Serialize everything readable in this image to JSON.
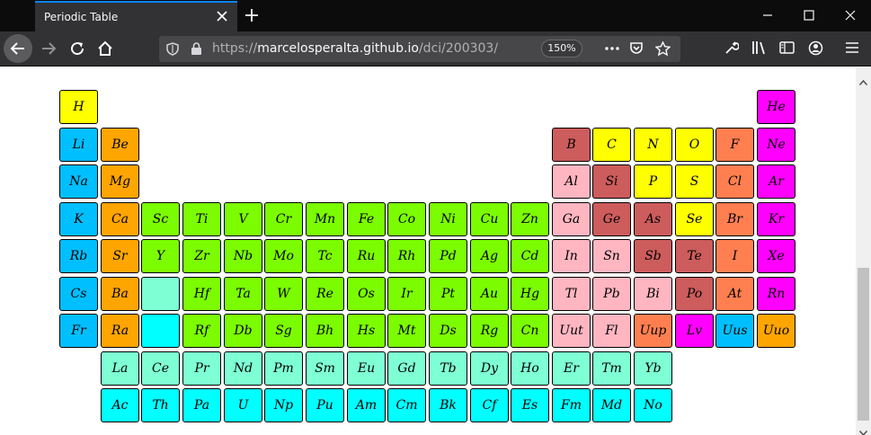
{
  "browser": {
    "tab_title": "Periodic Table",
    "url_prefix": "https://",
    "url_host": "marcelosperalta.github.io",
    "url_path": "/dci/200303/",
    "zoom": "150%"
  },
  "colors": {
    "hydrogen": "#ffff00",
    "alkali": "#00bfff",
    "alkaline_earth": "#ffa500",
    "transition": "#7cfc00",
    "metalloid": "#cd5c5c",
    "post_transition": "#ffb6c1",
    "nonmetal": "#ffff00",
    "halogen": "#ff7f50",
    "noble_gas": "#ff00ff",
    "lanthanide": "#7fffd4",
    "actinide": "#00ffff"
  },
  "elements": [
    {
      "symbol": "H",
      "row": 1,
      "col": 1,
      "category": "hydrogen"
    },
    {
      "symbol": "He",
      "row": 1,
      "col": 18,
      "category": "noble_gas"
    },
    {
      "symbol": "Li",
      "row": 2,
      "col": 1,
      "category": "alkali"
    },
    {
      "symbol": "Be",
      "row": 2,
      "col": 2,
      "category": "alkaline_earth"
    },
    {
      "symbol": "B",
      "row": 2,
      "col": 13,
      "category": "metalloid"
    },
    {
      "symbol": "C",
      "row": 2,
      "col": 14,
      "category": "nonmetal"
    },
    {
      "symbol": "N",
      "row": 2,
      "col": 15,
      "category": "nonmetal"
    },
    {
      "symbol": "O",
      "row": 2,
      "col": 16,
      "category": "nonmetal"
    },
    {
      "symbol": "F",
      "row": 2,
      "col": 17,
      "category": "halogen"
    },
    {
      "symbol": "Ne",
      "row": 2,
      "col": 18,
      "category": "noble_gas"
    },
    {
      "symbol": "Na",
      "row": 3,
      "col": 1,
      "category": "alkali"
    },
    {
      "symbol": "Mg",
      "row": 3,
      "col": 2,
      "category": "alkaline_earth"
    },
    {
      "symbol": "Al",
      "row": 3,
      "col": 13,
      "category": "post_transition"
    },
    {
      "symbol": "Si",
      "row": 3,
      "col": 14,
      "category": "metalloid"
    },
    {
      "symbol": "P",
      "row": 3,
      "col": 15,
      "category": "nonmetal"
    },
    {
      "symbol": "S",
      "row": 3,
      "col": 16,
      "category": "nonmetal"
    },
    {
      "symbol": "Cl",
      "row": 3,
      "col": 17,
      "category": "halogen"
    },
    {
      "symbol": "Ar",
      "row": 3,
      "col": 18,
      "category": "noble_gas"
    },
    {
      "symbol": "K",
      "row": 4,
      "col": 1,
      "category": "alkali"
    },
    {
      "symbol": "Ca",
      "row": 4,
      "col": 2,
      "category": "alkaline_earth"
    },
    {
      "symbol": "Sc",
      "row": 4,
      "col": 3,
      "category": "transition"
    },
    {
      "symbol": "Ti",
      "row": 4,
      "col": 4,
      "category": "transition"
    },
    {
      "symbol": "V",
      "row": 4,
      "col": 5,
      "category": "transition"
    },
    {
      "symbol": "Cr",
      "row": 4,
      "col": 6,
      "category": "transition"
    },
    {
      "symbol": "Mn",
      "row": 4,
      "col": 7,
      "category": "transition"
    },
    {
      "symbol": "Fe",
      "row": 4,
      "col": 8,
      "category": "transition"
    },
    {
      "symbol": "Co",
      "row": 4,
      "col": 9,
      "category": "transition"
    },
    {
      "symbol": "Ni",
      "row": 4,
      "col": 10,
      "category": "transition"
    },
    {
      "symbol": "Cu",
      "row": 4,
      "col": 11,
      "category": "transition"
    },
    {
      "symbol": "Zn",
      "row": 4,
      "col": 12,
      "category": "transition"
    },
    {
      "symbol": "Ga",
      "row": 4,
      "col": 13,
      "category": "post_transition"
    },
    {
      "symbol": "Ge",
      "row": 4,
      "col": 14,
      "category": "metalloid"
    },
    {
      "symbol": "As",
      "row": 4,
      "col": 15,
      "category": "metalloid"
    },
    {
      "symbol": "Se",
      "row": 4,
      "col": 16,
      "category": "nonmetal"
    },
    {
      "symbol": "Br",
      "row": 4,
      "col": 17,
      "category": "halogen"
    },
    {
      "symbol": "Kr",
      "row": 4,
      "col": 18,
      "category": "noble_gas"
    },
    {
      "symbol": "Rb",
      "row": 5,
      "col": 1,
      "category": "alkali"
    },
    {
      "symbol": "Sr",
      "row": 5,
      "col": 2,
      "category": "alkaline_earth"
    },
    {
      "symbol": "Y",
      "row": 5,
      "col": 3,
      "category": "transition"
    },
    {
      "symbol": "Zr",
      "row": 5,
      "col": 4,
      "category": "transition"
    },
    {
      "symbol": "Nb",
      "row": 5,
      "col": 5,
      "category": "transition"
    },
    {
      "symbol": "Mo",
      "row": 5,
      "col": 6,
      "category": "transition"
    },
    {
      "symbol": "Tc",
      "row": 5,
      "col": 7,
      "category": "transition"
    },
    {
      "symbol": "Ru",
      "row": 5,
      "col": 8,
      "category": "transition"
    },
    {
      "symbol": "Rh",
      "row": 5,
      "col": 9,
      "category": "transition"
    },
    {
      "symbol": "Pd",
      "row": 5,
      "col": 10,
      "category": "transition"
    },
    {
      "symbol": "Ag",
      "row": 5,
      "col": 11,
      "category": "transition"
    },
    {
      "symbol": "Cd",
      "row": 5,
      "col": 12,
      "category": "transition"
    },
    {
      "symbol": "In",
      "row": 5,
      "col": 13,
      "category": "post_transition"
    },
    {
      "symbol": "Sn",
      "row": 5,
      "col": 14,
      "category": "post_transition"
    },
    {
      "symbol": "Sb",
      "row": 5,
      "col": 15,
      "category": "metalloid"
    },
    {
      "symbol": "Te",
      "row": 5,
      "col": 16,
      "category": "metalloid"
    },
    {
      "symbol": "I",
      "row": 5,
      "col": 17,
      "category": "halogen"
    },
    {
      "symbol": "Xe",
      "row": 5,
      "col": 18,
      "category": "noble_gas"
    },
    {
      "symbol": "Cs",
      "row": 6,
      "col": 1,
      "category": "alkali"
    },
    {
      "symbol": "Ba",
      "row": 6,
      "col": 2,
      "category": "alkaline_earth"
    },
    {
      "symbol": "",
      "row": 6,
      "col": 3,
      "category": "lanthanide"
    },
    {
      "symbol": "Hf",
      "row": 6,
      "col": 4,
      "category": "transition"
    },
    {
      "symbol": "Ta",
      "row": 6,
      "col": 5,
      "category": "transition"
    },
    {
      "symbol": "W",
      "row": 6,
      "col": 6,
      "category": "transition"
    },
    {
      "symbol": "Re",
      "row": 6,
      "col": 7,
      "category": "transition"
    },
    {
      "symbol": "Os",
      "row": 6,
      "col": 8,
      "category": "transition"
    },
    {
      "symbol": "Ir",
      "row": 6,
      "col": 9,
      "category": "transition"
    },
    {
      "symbol": "Pt",
      "row": 6,
      "col": 10,
      "category": "transition"
    },
    {
      "symbol": "Au",
      "row": 6,
      "col": 11,
      "category": "transition"
    },
    {
      "symbol": "Hg",
      "row": 6,
      "col": 12,
      "category": "transition"
    },
    {
      "symbol": "Tl",
      "row": 6,
      "col": 13,
      "category": "post_transition"
    },
    {
      "symbol": "Pb",
      "row": 6,
      "col": 14,
      "category": "post_transition"
    },
    {
      "symbol": "Bi",
      "row": 6,
      "col": 15,
      "category": "post_transition"
    },
    {
      "symbol": "Po",
      "row": 6,
      "col": 16,
      "category": "metalloid"
    },
    {
      "symbol": "At",
      "row": 6,
      "col": 17,
      "category": "halogen"
    },
    {
      "symbol": "Rn",
      "row": 6,
      "col": 18,
      "category": "noble_gas"
    },
    {
      "symbol": "Fr",
      "row": 7,
      "col": 1,
      "category": "alkali"
    },
    {
      "symbol": "Ra",
      "row": 7,
      "col": 2,
      "category": "alkaline_earth"
    },
    {
      "symbol": "",
      "row": 7,
      "col": 3,
      "category": "actinide"
    },
    {
      "symbol": "Rf",
      "row": 7,
      "col": 4,
      "category": "transition"
    },
    {
      "symbol": "Db",
      "row": 7,
      "col": 5,
      "category": "transition"
    },
    {
      "symbol": "Sg",
      "row": 7,
      "col": 6,
      "category": "transition"
    },
    {
      "symbol": "Bh",
      "row": 7,
      "col": 7,
      "category": "transition"
    },
    {
      "symbol": "Hs",
      "row": 7,
      "col": 8,
      "category": "transition"
    },
    {
      "symbol": "Mt",
      "row": 7,
      "col": 9,
      "category": "transition"
    },
    {
      "symbol": "Ds",
      "row": 7,
      "col": 10,
      "category": "transition"
    },
    {
      "symbol": "Rg",
      "row": 7,
      "col": 11,
      "category": "transition"
    },
    {
      "symbol": "Cn",
      "row": 7,
      "col": 12,
      "category": "transition"
    },
    {
      "symbol": "Uut",
      "row": 7,
      "col": 13,
      "category": "post_transition"
    },
    {
      "symbol": "Fl",
      "row": 7,
      "col": 14,
      "category": "post_transition"
    },
    {
      "symbol": "Uup",
      "row": 7,
      "col": 15,
      "category": "halogen"
    },
    {
      "symbol": "Lv",
      "row": 7,
      "col": 16,
      "category": "noble_gas"
    },
    {
      "symbol": "Uus",
      "row": 7,
      "col": 17,
      "category": "alkali"
    },
    {
      "symbol": "Uuo",
      "row": 7,
      "col": 18,
      "category": "alkaline_earth"
    },
    {
      "symbol": "La",
      "row": 8,
      "col": 2,
      "category": "lanthanide"
    },
    {
      "symbol": "Ce",
      "row": 8,
      "col": 3,
      "category": "lanthanide"
    },
    {
      "symbol": "Pr",
      "row": 8,
      "col": 4,
      "category": "lanthanide"
    },
    {
      "symbol": "Nd",
      "row": 8,
      "col": 5,
      "category": "lanthanide"
    },
    {
      "symbol": "Pm",
      "row": 8,
      "col": 6,
      "category": "lanthanide"
    },
    {
      "symbol": "Sm",
      "row": 8,
      "col": 7,
      "category": "lanthanide"
    },
    {
      "symbol": "Eu",
      "row": 8,
      "col": 8,
      "category": "lanthanide"
    },
    {
      "symbol": "Gd",
      "row": 8,
      "col": 9,
      "category": "lanthanide"
    },
    {
      "symbol": "Tb",
      "row": 8,
      "col": 10,
      "category": "lanthanide"
    },
    {
      "symbol": "Dy",
      "row": 8,
      "col": 11,
      "category": "lanthanide"
    },
    {
      "symbol": "Ho",
      "row": 8,
      "col": 12,
      "category": "lanthanide"
    },
    {
      "symbol": "Er",
      "row": 8,
      "col": 13,
      "category": "lanthanide"
    },
    {
      "symbol": "Tm",
      "row": 8,
      "col": 14,
      "category": "lanthanide"
    },
    {
      "symbol": "Yb",
      "row": 8,
      "col": 15,
      "category": "lanthanide"
    },
    {
      "symbol": "Ac",
      "row": 9,
      "col": 2,
      "category": "actinide"
    },
    {
      "symbol": "Th",
      "row": 9,
      "col": 3,
      "category": "actinide"
    },
    {
      "symbol": "Pa",
      "row": 9,
      "col": 4,
      "category": "actinide"
    },
    {
      "symbol": "U",
      "row": 9,
      "col": 5,
      "category": "actinide"
    },
    {
      "symbol": "Np",
      "row": 9,
      "col": 6,
      "category": "actinide"
    },
    {
      "symbol": "Pu",
      "row": 9,
      "col": 7,
      "category": "actinide"
    },
    {
      "symbol": "Am",
      "row": 9,
      "col": 8,
      "category": "actinide"
    },
    {
      "symbol": "Cm",
      "row": 9,
      "col": 9,
      "category": "actinide"
    },
    {
      "symbol": "Bk",
      "row": 9,
      "col": 10,
      "category": "actinide"
    },
    {
      "symbol": "Cf",
      "row": 9,
      "col": 11,
      "category": "actinide"
    },
    {
      "symbol": "Es",
      "row": 9,
      "col": 12,
      "category": "actinide"
    },
    {
      "symbol": "Fm",
      "row": 9,
      "col": 13,
      "category": "actinide"
    },
    {
      "symbol": "Md",
      "row": 9,
      "col": 14,
      "category": "actinide"
    },
    {
      "symbol": "No",
      "row": 9,
      "col": 15,
      "category": "actinide"
    }
  ]
}
